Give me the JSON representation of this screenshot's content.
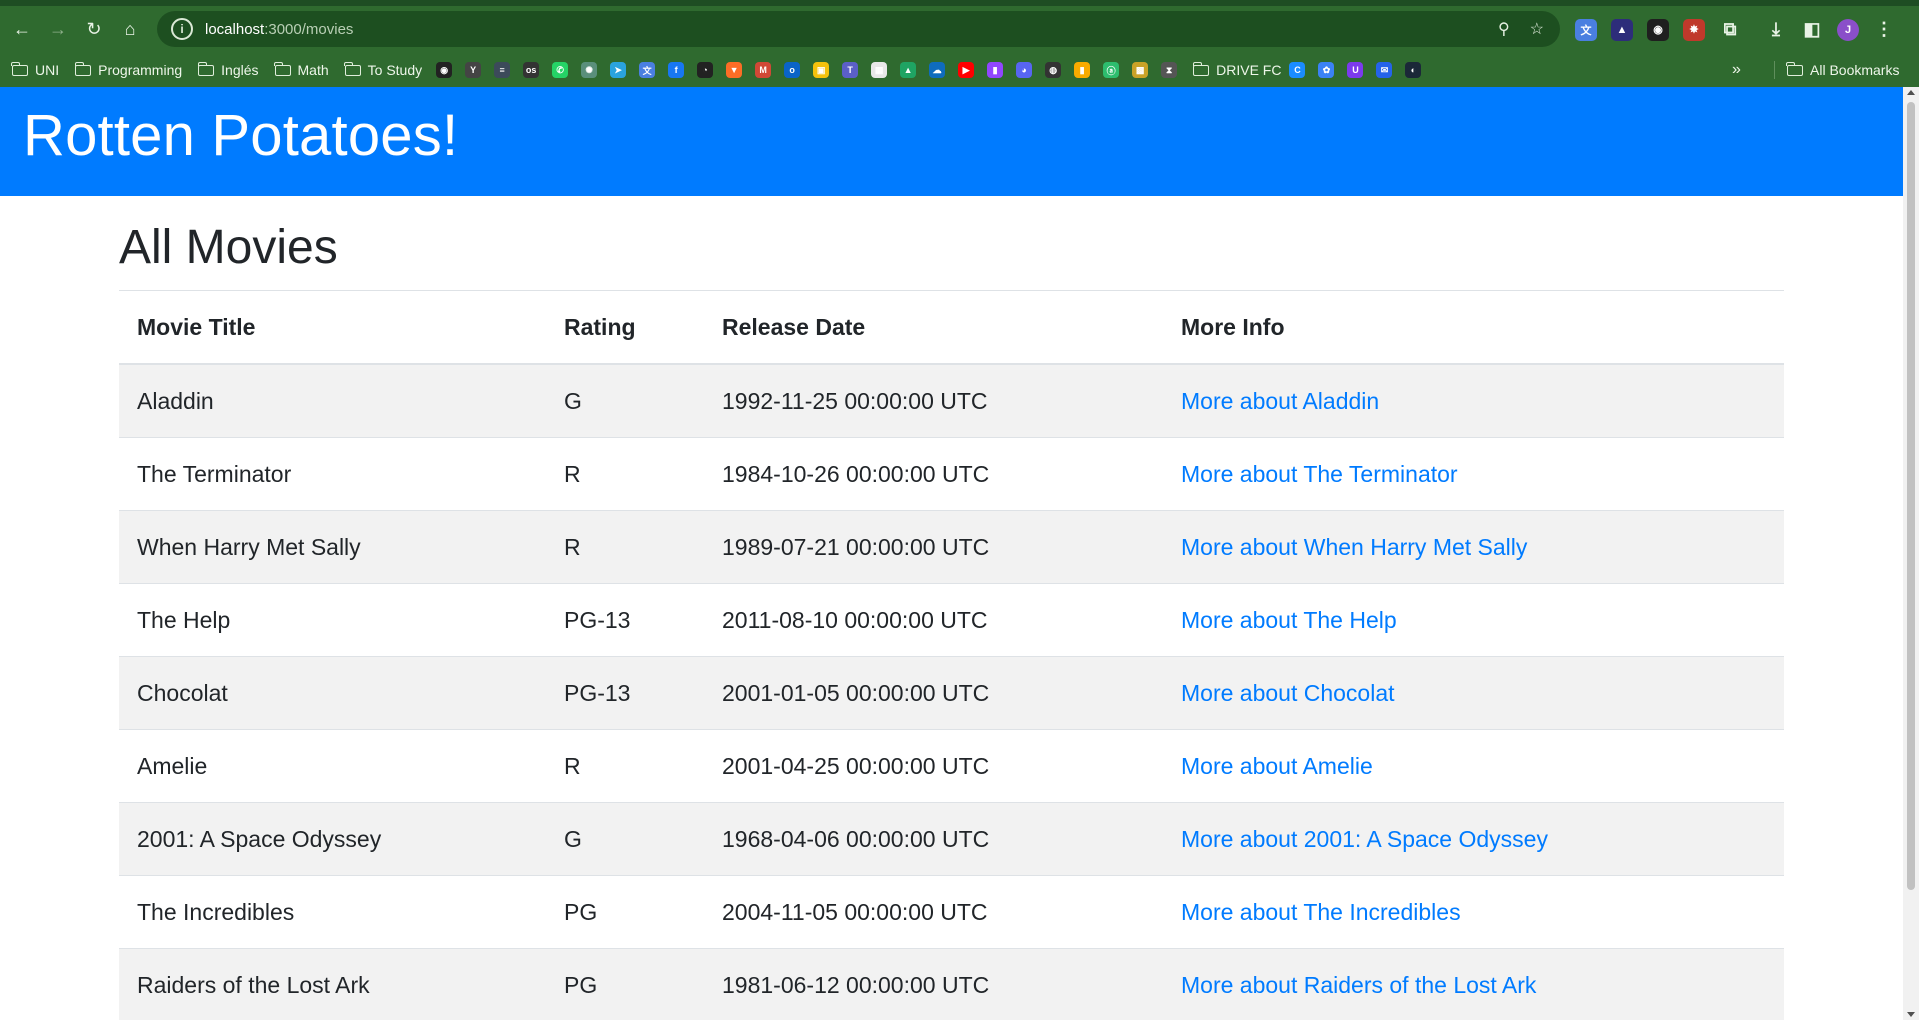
{
  "browser": {
    "url_host": "localhost",
    "url_path": ":3000/movies",
    "bookmarks_folders_left": [
      "UNI",
      "Programming",
      "Inglés",
      "Math",
      "To Study"
    ],
    "bookmark_folder_middle": "DRIVE FC",
    "bookmark_all": "All Bookmarks",
    "favicons": [
      {
        "name": "ai-favicon",
        "color": "#222222",
        "glyph": "◉"
      },
      {
        "name": "scholar-favicon",
        "color": "#444444",
        "glyph": "Y"
      },
      {
        "name": "doc-favicon",
        "color": "#3c4a5a",
        "glyph": "≡"
      },
      {
        "name": "osi-favicon",
        "color": "#333333",
        "glyph": "os"
      },
      {
        "name": "whatsapp-favicon",
        "color": "#25d366",
        "glyph": "✆"
      },
      {
        "name": "chatgpt-favicon",
        "color": "#5a8f7b",
        "glyph": "✺"
      },
      {
        "name": "telegram-favicon",
        "color": "#2aa3de",
        "glyph": "➤"
      },
      {
        "name": "translate-favicon",
        "color": "#4a7fe0",
        "glyph": "文"
      },
      {
        "name": "facebook-favicon",
        "color": "#1877f2",
        "glyph": "f"
      },
      {
        "name": "github-favicon",
        "color": "#222222",
        "glyph": "◔"
      },
      {
        "name": "gitlab-favicon",
        "color": "#fc6d26",
        "glyph": "▼"
      },
      {
        "name": "gmail-favicon",
        "color": "#d14836",
        "glyph": "M"
      },
      {
        "name": "outlook-favicon",
        "color": "#0a64c8",
        "glyph": "o"
      },
      {
        "name": "keep-favicon",
        "color": "#f4c20d",
        "glyph": "▣"
      },
      {
        "name": "teams-favicon",
        "color": "#5b5fc7",
        "glyph": "T"
      },
      {
        "name": "calendar-favicon",
        "color": "#e8e8e8",
        "glyph": "▦"
      },
      {
        "name": "drive-favicon",
        "color": "#1fa463",
        "glyph": "▲"
      },
      {
        "name": "onedrive-favicon",
        "color": "#0f6cbd",
        "glyph": "☁"
      },
      {
        "name": "youtube-favicon",
        "color": "#ff0000",
        "glyph": "▶"
      },
      {
        "name": "twitch-favicon",
        "color": "#9146ff",
        "glyph": "▮"
      },
      {
        "name": "discord-favicon",
        "color": "#5865f2",
        "glyph": "◕"
      },
      {
        "name": "globe-favicon",
        "color": "#333333",
        "glyph": "◍"
      },
      {
        "name": "analytics-favicon",
        "color": "#f9ab00",
        "glyph": "▮"
      },
      {
        "name": "app-favicon",
        "color": "#2dbd6e",
        "glyph": "ⓐ"
      },
      {
        "name": "photo-favicon",
        "color": "#c9a227",
        "glyph": "▩"
      },
      {
        "name": "hourglass-favicon",
        "color": "#555555",
        "glyph": "⧗"
      }
    ],
    "favicons_after": [
      {
        "name": "copilot-favicon",
        "color": "#1a8cff",
        "glyph": "C"
      },
      {
        "name": "settings-favicon",
        "color": "#3b82f6",
        "glyph": "✿"
      },
      {
        "name": "proton-favicon",
        "color": "#7c3aed",
        "glyph": "U"
      },
      {
        "name": "mail-favicon",
        "color": "#2563eb",
        "glyph": "✉"
      },
      {
        "name": "steam-favicon",
        "color": "#1b2838",
        "glyph": "◐"
      }
    ],
    "extensions": [
      {
        "name": "translate-extension-icon",
        "color": "#4a7fe0",
        "glyph": "文"
      },
      {
        "name": "proton-extension-icon",
        "color": "#2d2d7a",
        "glyph": "▲"
      },
      {
        "name": "privacy-extension-icon",
        "color": "#1f1f1f",
        "glyph": "◉"
      },
      {
        "name": "shopping-extension-icon",
        "color": "#c0392b",
        "glyph": "✸"
      }
    ],
    "avatar_letter": "J"
  },
  "site": {
    "title": "Rotten Potatoes!"
  },
  "page": {
    "heading": "All Movies"
  },
  "table": {
    "headers": [
      "Movie Title",
      "Rating",
      "Release Date",
      "More Info"
    ],
    "rows": [
      {
        "title": "Aladdin",
        "rating": "G",
        "date": "1992-11-25 00:00:00 UTC",
        "link": "More about Aladdin"
      },
      {
        "title": "The Terminator",
        "rating": "R",
        "date": "1984-10-26 00:00:00 UTC",
        "link": "More about The Terminator"
      },
      {
        "title": "When Harry Met Sally",
        "rating": "R",
        "date": "1989-07-21 00:00:00 UTC",
        "link": "More about When Harry Met Sally"
      },
      {
        "title": "The Help",
        "rating": "PG-13",
        "date": "2011-08-10 00:00:00 UTC",
        "link": "More about The Help"
      },
      {
        "title": "Chocolat",
        "rating": "PG-13",
        "date": "2001-01-05 00:00:00 UTC",
        "link": "More about Chocolat"
      },
      {
        "title": "Amelie",
        "rating": "R",
        "date": "2001-04-25 00:00:00 UTC",
        "link": "More about Amelie"
      },
      {
        "title": "2001: A Space Odyssey",
        "rating": "G",
        "date": "1968-04-06 00:00:00 UTC",
        "link": "More about 2001: A Space Odyssey"
      },
      {
        "title": "The Incredibles",
        "rating": "PG",
        "date": "2004-11-05 00:00:00 UTC",
        "link": "More about The Incredibles"
      },
      {
        "title": "Raiders of the Lost Ark",
        "rating": "PG",
        "date": "1981-06-12 00:00:00 UTC",
        "link": "More about Raiders of the Lost Ark"
      }
    ]
  },
  "colors": {
    "banner": "#007bff",
    "link": "#007bff",
    "chrome": "#2f6a2f"
  }
}
